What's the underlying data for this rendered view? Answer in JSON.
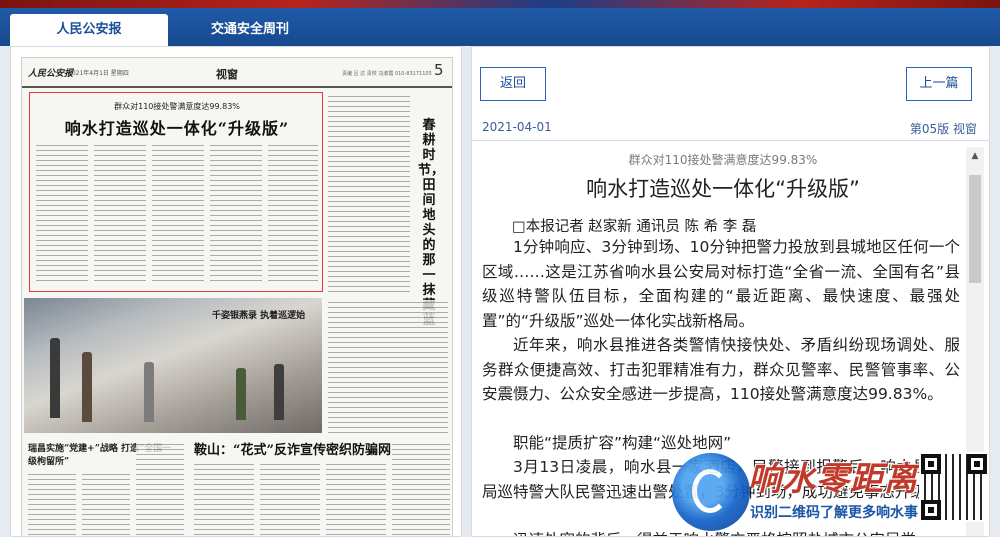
{
  "tabs": {
    "active": "人民公安报",
    "other": "交通安全周刊"
  },
  "newspaper": {
    "logo": "人民公安报",
    "date_line": "2021年4月1日 星期四",
    "section": "视窗",
    "editors_line": "责编 吕 达  责校 冯淑霞  010-83171105",
    "page_number": "5",
    "lead_subtitle": "群众对110接处警满意度达99.83%",
    "lead_title": "响水打造巡处一体化“升级版”",
    "vertical_title": "春耕时节，田间地头的那一抹藏蓝",
    "photo_caption": "千姿银燕录  执着巡逻始",
    "side_head": "瑞昌实施“党建+”战略 打造“全国一级枸留所”",
    "bottom_head": "鞍山：“花式”反诈宣传密织防骗网"
  },
  "reader": {
    "back_button": "返回",
    "prev_button": "上一篇",
    "date": "2021-04-01",
    "page_info": "第05版 视窗",
    "subtitle": "群众对110接处警满意度达99.83%",
    "title": "响水打造巡处一体化“升级版”",
    "byline": "□本报记者 赵家新 通讯员 陈 希 李 磊",
    "paragraphs": [
      "1分钟响应、3分钟到场、10分钟把警力投放到县城地区任何一个区域……这是江苏省响水县公安局对标打造“全省一流、全国有名”县级巡特警队伍目标，全面构建的“最近距离、最快速度、最强处置”的“升级版”巡处一体化实战新格局。",
      "近年来，响水县推进各类警情快接快处、矛盾纠纷现场调处、服务群众便捷高效、打击犯罪精准有力，群众见警率、民警管事率、公安震慑力、公众安全感进一步提高，110接处警满意度达99.83%。",
      "职能“提质扩容”构建“巡处地网”",
      "3月13日凌晨，响水县一家酒店，民警接到报警后，响水县公安局巡特警大队民警迅速出警处置，3分钟到场，成功避免事态升级。",
      "迅速处突的背后，得益于响水警方严格按照盐城市公安局党"
    ]
  },
  "watermark": {
    "brand": "响水零距离",
    "slogan": "识别二维码了解更多响水事"
  },
  "colors": {
    "tab_bar": "#1f5aa8",
    "accent_blue": "#1b4e9b",
    "highlight_red": "#e23a3a",
    "watermark_red": "#c0392b"
  }
}
